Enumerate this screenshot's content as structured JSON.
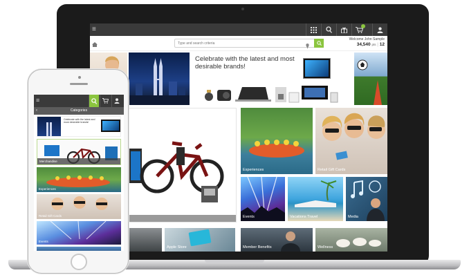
{
  "header": {
    "menu_glyph": "≡",
    "icons": [
      "grid-icon",
      "search-icon",
      "gift-icon",
      "cart-icon",
      "user-icon"
    ],
    "welcome_text": "Welcome John Sample",
    "points_value": "34,540",
    "points_unit": "pts",
    "cart_count": "12"
  },
  "search": {
    "placeholder": "Type and search criteria"
  },
  "banner": {
    "headline": "Celebrate with the latest and most desirable brands!"
  },
  "tiles": {
    "experiences": "Experiences",
    "retail_gift_cards": "Retail Gift Cards",
    "events": "Events",
    "vacations_travel": "Vacations Travel",
    "media": "Media",
    "apple_store": "Apple Store",
    "member_benefits": "Member Benefits",
    "wellness": "Wellness"
  },
  "phone": {
    "title": "Categories",
    "banner_text": "Celebrate with the latest and most desirable brands!",
    "items": [
      "Merchandise",
      "Experiences",
      "Retail Gift Cards",
      "Events"
    ]
  },
  "colors": {
    "accent": "#8bc53f",
    "topbar": "#3a3a3a"
  }
}
